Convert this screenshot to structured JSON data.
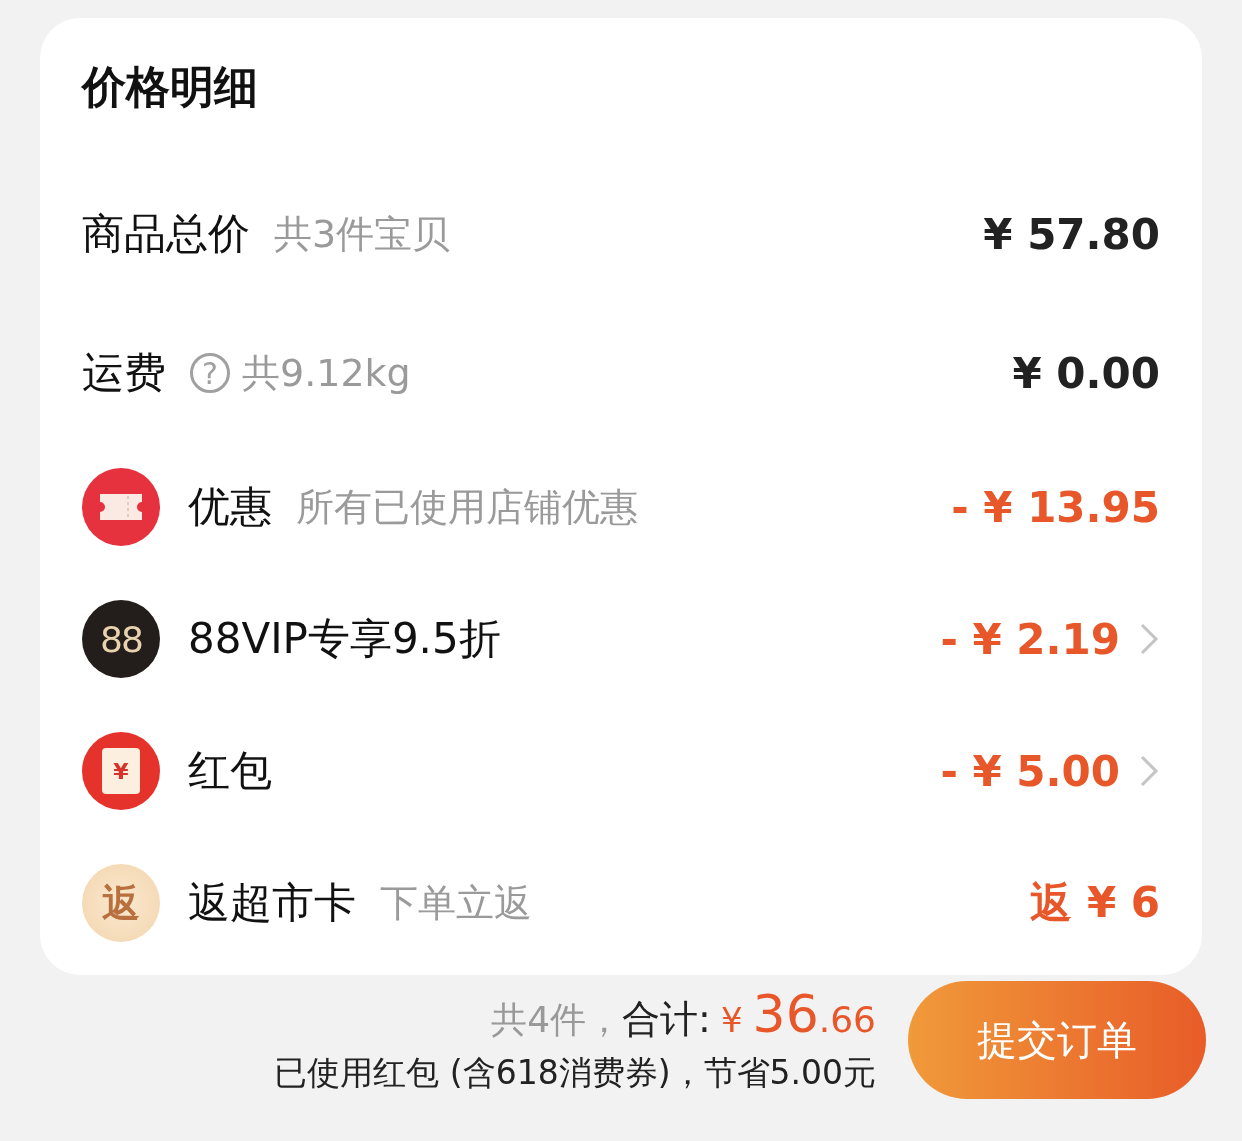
{
  "title": "价格明细",
  "rows": [
    {
      "kind": "plain",
      "label": "商品总价",
      "help": null,
      "note": "共3件宝贝",
      "amount": "¥ 57.80",
      "highlight": false,
      "has_arrow": false
    },
    {
      "kind": "plain",
      "label": "运费",
      "help": "?",
      "note": "共9.12kg",
      "amount": "¥ 0.00",
      "highlight": false,
      "has_arrow": false
    },
    {
      "kind": "ticket",
      "label": "优惠",
      "note": "所有已使用店铺优惠",
      "amount": "- ¥ 13.95",
      "highlight": true,
      "has_arrow": false
    },
    {
      "kind": "vip",
      "badge": "88",
      "label": "88VIP专享9.5折",
      "amount": "- ¥ 2.19",
      "highlight": true,
      "has_arrow": true
    },
    {
      "kind": "redpacket",
      "badge": "¥",
      "label": "红包",
      "amount": "- ¥ 5.00",
      "highlight": true,
      "has_arrow": true
    },
    {
      "kind": "rebate",
      "badge": "返",
      "label": "返超市卡",
      "note": "下单立返",
      "amount": "返 ¥ 6",
      "highlight": true,
      "has_arrow": false
    }
  ],
  "footer": {
    "count": "共4件，",
    "total_label": "合计:",
    "currency": "¥",
    "integer": "36",
    "decimal": ".66",
    "savings": "已使用红包 (含618消费券)，节省5.00元",
    "submit": "提交订单"
  }
}
